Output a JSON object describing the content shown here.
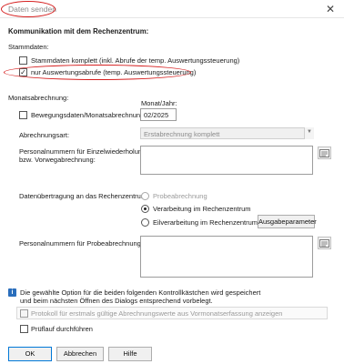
{
  "window": {
    "title": "Daten senden",
    "close_glyph": "✕"
  },
  "section": {
    "heading": "Kommunikation mit dem Rechenzentrum:"
  },
  "stammdaten": {
    "label": "Stammdaten:",
    "opt_komplett": {
      "label": "Stammdaten komplett (inkl. Abrufe der temp. Auswertungssteuerung)",
      "checked": false
    },
    "opt_nur": {
      "label": "nur Auswertungsabrufe (temp. Auswertungssteuerung)",
      "checked": true
    }
  },
  "monat": {
    "label": "Monatsabrechnung:",
    "bewegungsdaten_label": "Bewegungsdaten/Monatsabrechnung",
    "bewegungsdaten_checked": false,
    "monat_jahr_label": "Monat/Jahr:",
    "monat_jahr_value": "02/2025",
    "abrechnungsart_label": "Abrechnungsart:",
    "abrechnungsart_value": "Erstabrechnung komplett",
    "persnr_wiederholung_label_1": "Personalnummern für Einzelwiederholung",
    "persnr_wiederholung_label_2": "bzw. Vorwegabrechnung:"
  },
  "uebertragung": {
    "label": "Datenübertragung an das Rechenzentrum:",
    "options": [
      {
        "label": "Probeabrechnung",
        "selected": false,
        "disabled": true
      },
      {
        "label": "Verarbeitung im Rechenzentrum",
        "selected": true,
        "disabled": false
      },
      {
        "label": "Eilverarbeitung im Rechenzentrum",
        "selected": false,
        "disabled": false
      }
    ],
    "ausgabe_button": "Ausgabeparameter"
  },
  "probe": {
    "label": "Personalnummern für Probeabrechnung:"
  },
  "info": {
    "icon_glyph": "i",
    "line1": "Die gewählte Option für die beiden folgenden Kontrollkästchen wird gespeichert",
    "line2": "und beim nächsten Öffnen des Dialogs entsprechend vorbelegt."
  },
  "protokoll": {
    "label": "Protokoll für erstmals gültige Abrechnungswerte aus Vormonatserfassung anzeigen",
    "checked": false,
    "disabled": true
  },
  "pruefung": {
    "label": "Prüflauf durchführen",
    "checked": false
  },
  "buttons": {
    "ok": "OK",
    "abbrechen": "Abbrechen",
    "hilfe": "Hilfe"
  },
  "colors": {
    "highlight_ellipse": "#d62020",
    "info_icon": "#2a6ebc"
  }
}
